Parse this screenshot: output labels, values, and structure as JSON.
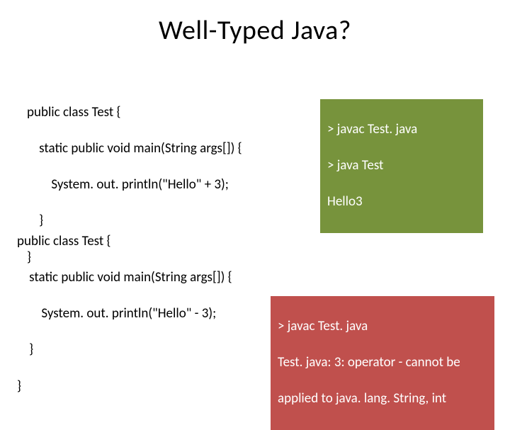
{
  "title": "Well-Typed Java?",
  "code1": {
    "l1": "public class Test {",
    "l2": "    static public void main(String args[]) {",
    "l3": "        System. out. println(\"Hello\" + 3);",
    "l4": "    }",
    "l5": "}"
  },
  "output1": {
    "l1": "> javac Test. java",
    "l2": "> java Test",
    "l3": "Hello3"
  },
  "code2": {
    "l1": "public class Test {",
    "l2": "    static public void main(String args[]) {",
    "l3": "        System. out. println(\"Hello\" - 3);",
    "l4": "    }",
    "l5": "}"
  },
  "output2": {
    "l1": "> javac Test. java",
    "l2": "Test. java: 3: operator - cannot be",
    "l3": "applied to java. lang. String, int"
  }
}
